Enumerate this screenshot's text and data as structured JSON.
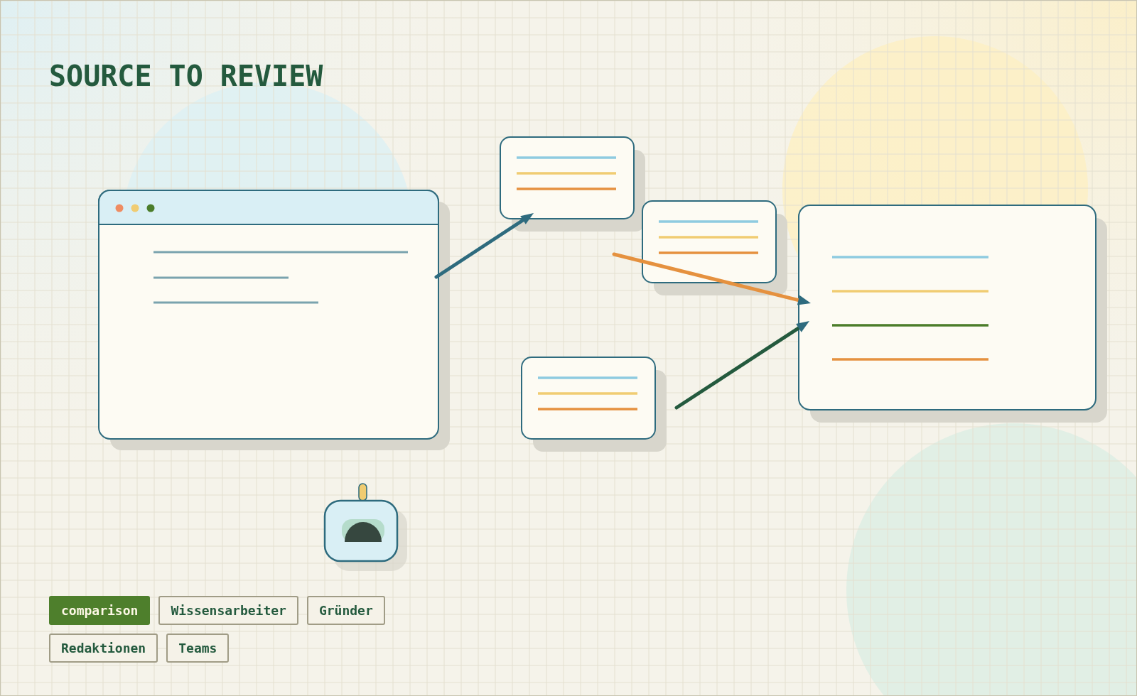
{
  "title": "SOURCE TO REVIEW",
  "tags": [
    {
      "label": "comparison",
      "selected": true
    },
    {
      "label": "Wissensarbeiter",
      "selected": false
    },
    {
      "label": "Gründer",
      "selected": false
    },
    {
      "label": "Redaktionen",
      "selected": false
    },
    {
      "label": "Teams",
      "selected": false
    }
  ]
}
